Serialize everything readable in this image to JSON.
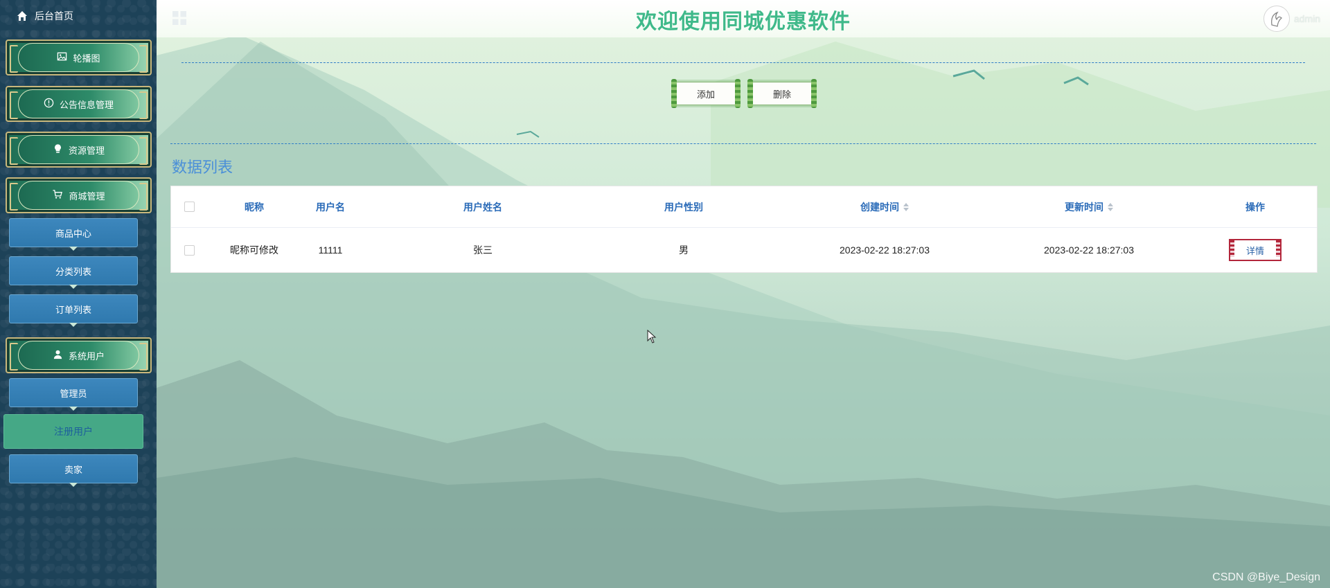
{
  "sidebar": {
    "home_label": "后台首页",
    "items": [
      {
        "label": "轮播图",
        "type": "main",
        "icon": "image-icon"
      },
      {
        "label": "公告信息管理",
        "type": "main",
        "icon": "info-circle-icon"
      },
      {
        "label": "资源管理",
        "type": "main",
        "icon": "bulb-icon"
      },
      {
        "label": "商城管理",
        "type": "main",
        "icon": "cart-icon"
      },
      {
        "label": "商品中心",
        "type": "sub"
      },
      {
        "label": "分类列表",
        "type": "sub"
      },
      {
        "label": "订单列表",
        "type": "sub"
      },
      {
        "label": "系统用户",
        "type": "main",
        "icon": "user-icon"
      },
      {
        "label": "管理员",
        "type": "sub"
      },
      {
        "label": "注册用户",
        "type": "sub",
        "active": true
      },
      {
        "label": "卖家",
        "type": "sub"
      }
    ]
  },
  "header": {
    "title": "欢迎使用同城优惠软件",
    "username": "admin"
  },
  "toolbar": {
    "add_label": "添加",
    "delete_label": "删除"
  },
  "section_title": "数据列表",
  "table": {
    "columns": [
      "昵称",
      "用户名",
      "用户姓名",
      "用户性别",
      "创建时间",
      "更新时间",
      "操作"
    ],
    "rows": [
      {
        "nickname": "昵称可修改",
        "username": "11111",
        "realname": "张三",
        "gender": "男",
        "created": "2023-02-22 18:27:03",
        "updated": "2023-02-22 18:27:03",
        "action": "详情"
      }
    ]
  },
  "watermark": "CSDN @Biye_Design",
  "colors": {
    "title": "#3fb98a",
    "section_title": "#4a8fd8",
    "header_text": "#2a6bb8",
    "sidebar_bg": "#1d4258",
    "active_item": "#45a886"
  }
}
